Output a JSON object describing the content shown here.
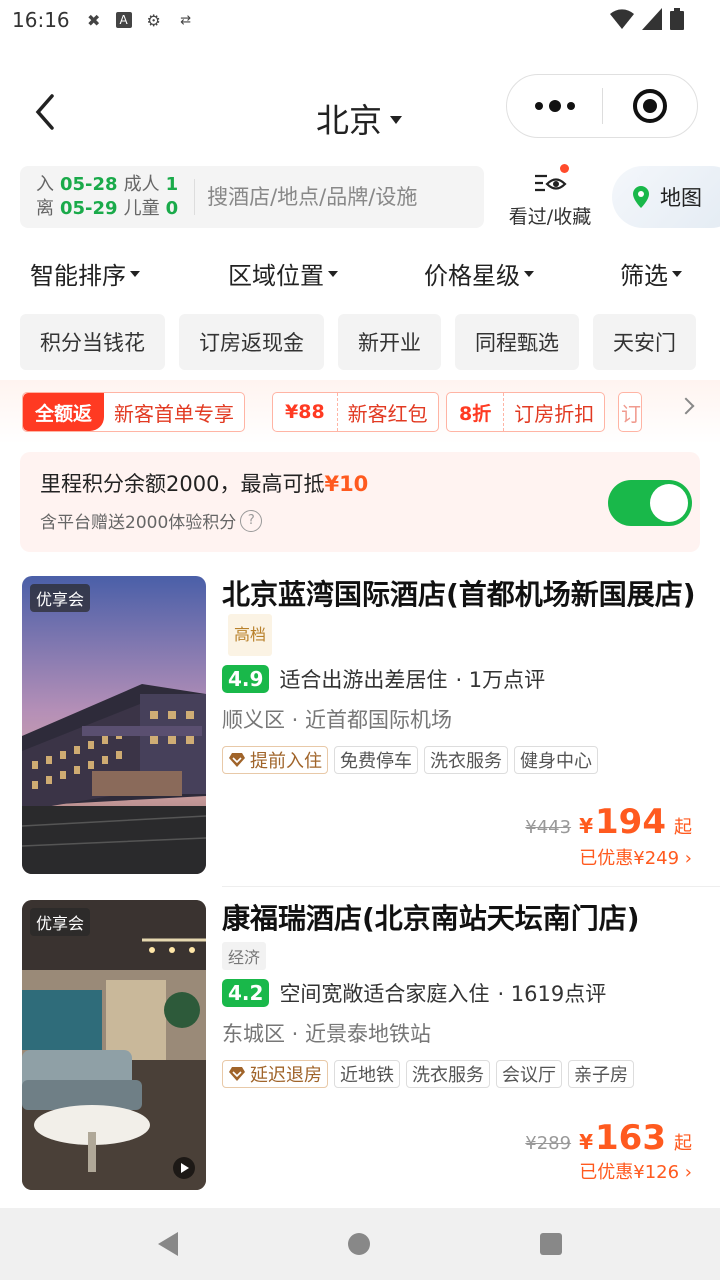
{
  "status_bar": {
    "time": "16:16",
    "icons": [
      "puzzle-icon",
      "a-icon",
      "gear-icon",
      "sync-icon"
    ],
    "right_icons": [
      "wifi-icon",
      "signal-icon",
      "battery-icon"
    ]
  },
  "header": {
    "city": "北京",
    "capsule": {
      "more": "more-icon",
      "close": "target-icon"
    }
  },
  "search": {
    "checkin_label": "入",
    "checkin_date": "05-28",
    "checkout_label": "离",
    "checkout_date": "05-29",
    "adult_label": "成人",
    "adult_count": "1",
    "child_label": "儿童",
    "child_count": "0",
    "placeholder": "搜酒店/地点/品牌/设施",
    "favorites_label": "看过/收藏",
    "map_label": "地图"
  },
  "filters": [
    "智能排序",
    "区域位置",
    "价格星级",
    "筛选"
  ],
  "chips": [
    "积分当钱花",
    "订房返现金",
    "新开业",
    "同程甄选",
    "天安门"
  ],
  "promos": [
    {
      "tag": "全额返",
      "text": "新客首单专享"
    },
    {
      "tag": "¥88",
      "text": "新客红包"
    },
    {
      "tag": "8折",
      "text": "订房折扣"
    },
    {
      "tag": "",
      "text": "订"
    }
  ],
  "points_banner": {
    "text": "里程积分余额2000，最高可抵",
    "amount": "¥10",
    "sub": "含平台赠送2000体验积分",
    "help": "?",
    "toggle_on": true
  },
  "hotels": [
    {
      "badge": "优享会",
      "name": "北京蓝湾国际酒店(首都机场新国展店)",
      "grade": "高档",
      "score": "4.9",
      "desc": "适合出游出差居住",
      "reviews": "· 1万点评",
      "location": "顺义区 · 近首都国际机场",
      "tags": [
        "提前入住",
        "免费停车",
        "洗衣服务",
        "健身中心"
      ],
      "orig_price": "¥443",
      "currency": "¥",
      "price": "194",
      "qi": "起",
      "discount": "已优惠¥249"
    },
    {
      "badge": "优享会",
      "name": "康福瑞酒店(北京南站天坛南门店)",
      "grade": "经济",
      "score": "4.2",
      "desc": "空间宽敞适合家庭入住",
      "reviews": "· 1619点评",
      "location": "东城区 · 近景泰地铁站",
      "tags": [
        "延迟退房",
        "近地铁",
        "洗衣服务",
        "会议厅",
        "亲子房"
      ],
      "orig_price": "¥289",
      "currency": "¥",
      "price": "163",
      "qi": "起",
      "discount": "已优惠¥126"
    }
  ],
  "colors": {
    "brand_green": "#19b84a",
    "price_orange": "#ff5a1f",
    "promo_red": "#ff3a22"
  }
}
